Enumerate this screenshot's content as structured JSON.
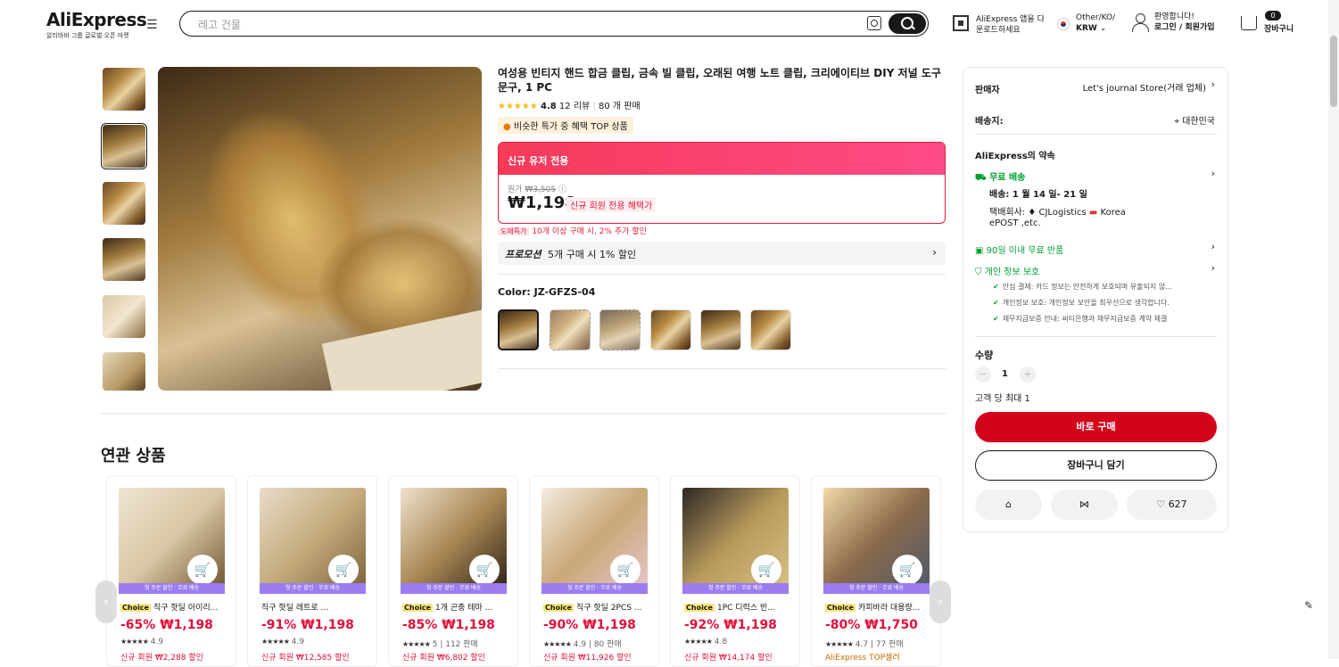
{
  "header": {
    "logo": "AliExpress",
    "logo_sub": "알리바바 그룹 글로벌 오픈 마켓",
    "search_placeholder": "레고 건물",
    "app_line1": "AliExpress 앱을 다",
    "app_line2": "운로드하세요",
    "lang_line1": "Other/KO/",
    "lang_line2": "KRW",
    "user_line1": "환영합니다!",
    "user_line2": "로그인 / 회원가입",
    "cart_count": "0",
    "cart_label": "장바구니"
  },
  "product": {
    "title": "여성용 빈티지 핸드 합금 클립, 금속 빌 클립, 오래된 여행 노트 클립, 크리에이티브 DIY 저널 도구 문구, 1 PC",
    "rating": "4.8",
    "reviews": "12 리뷰",
    "sold": "80 개 판매",
    "top_badge": "비슷한 특가 중 혜택 TOP 상품",
    "promo_header": "신규 유저 전용",
    "orig_label": "원가",
    "orig_price": "₩3,505",
    "price": "₩1,198",
    "price_tag": "신규 회원 전용 혜택가",
    "bulk_tag": "도매특가",
    "bulk_text": "10개 이상 구매 시, 2% 추가 할인",
    "promotion_label": "프로모션",
    "promotion_text": "5개 구매 시 1% 할인",
    "color_label": "Color: JZ-GFZS-04"
  },
  "panel": {
    "seller_label": "판매자",
    "seller_value": "Let's journal Store(거래 업체)",
    "ship_to_label": "배송지:",
    "ship_to_value": "대한민국",
    "promise_title": "AliExpress의 약속",
    "free_ship": "무료 배송",
    "delivery": "배송: 1 월 14 일- 21 일",
    "carrier_label": "택배회사:",
    "carrier1": "CJLogistics",
    "carrier2": "Korea",
    "carrier3": "ePOST ,etc.",
    "return": "90일 이내 무료 반품",
    "privacy": "개인 정보 보호",
    "privacy_items": [
      "안심 결제: 카드 정보는 안전하게 보호되며 유출되지 않...",
      "개인정보 보호: 개인정보 보안을 최우선으로 생각합니다.",
      "채무지급보증 안내: 씨티은행과 채무지급보증 계약 체결"
    ],
    "qty_label": "수량",
    "qty_value": "1",
    "qty_limit": "고객 당 최대 1",
    "buy_now": "바로 구매",
    "add_cart": "장바구니 담기",
    "wish_count": "627"
  },
  "related": {
    "title": "연관 상품",
    "items": [
      {
        "banner": "첫 주문 할인 · 무료 배송",
        "badge": "Choice",
        "name": "직구 핫딜 아이리...",
        "price": "-65% ₩1,198",
        "rating": "4.9",
        "extra": "",
        "note": "신규 회원 ₩2,288 할인"
      },
      {
        "banner": "첫 주문 할인 · 무료 배송",
        "badge": "",
        "name": "직구 핫딜 레트로 ...",
        "price": "-91% ₩1,198",
        "rating": "4.9",
        "extra": "",
        "note": "신규 회원 ₩12,585 할인"
      },
      {
        "banner": "첫 주문 할인 · 무료 배송",
        "badge": "Choice",
        "name": "1개 곤충 테마 ...",
        "price": "-85% ₩1,198",
        "rating": "5",
        "extra": "112 판매",
        "note": "신규 회원 ₩6,802 할인"
      },
      {
        "banner": "첫 주문 할인 · 무료 배송",
        "badge": "Choice",
        "name": "직구 핫딜 2PCS ...",
        "price": "-90% ₩1,198",
        "rating": "4.9",
        "extra": "80 판매",
        "note": "신규 회원 ₩11,926 할인"
      },
      {
        "banner": "첫 주문 할인 · 무료 배송",
        "badge": "Choice",
        "name": "1PC 디럭스 빈...",
        "price": "-92% ₩1,198",
        "rating": "4.8",
        "extra": "",
        "note": "신규 회원 ₩14,174 할인"
      },
      {
        "banner": "첫 주문 할인 · 무료 배송",
        "badge": "Choice",
        "name": "카피바라 대용량...",
        "price": "-80% ₩1,750",
        "rating": "4.7",
        "extra": "77 판매",
        "note": "AliExpress TOP셀러"
      }
    ]
  },
  "colors": {
    "accent": "#d3031c",
    "green": "#00a030",
    "promo_gradient": "#f63a58"
  }
}
